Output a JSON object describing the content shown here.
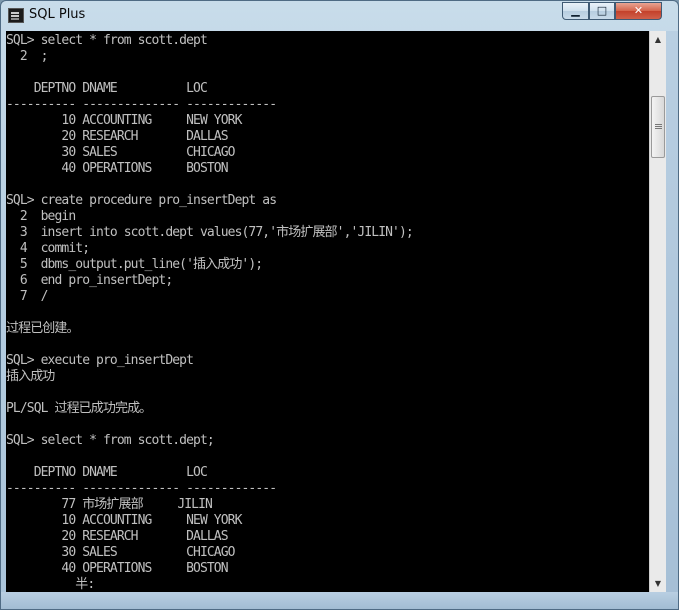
{
  "window": {
    "title": "SQL Plus",
    "minimize_glyph": "▁",
    "maximize_glyph": "□",
    "close_glyph": "✕",
    "icon": "sqlplus-app-icon"
  },
  "console": {
    "lines": [
      "SQL> select * from scott.dept",
      "  2  ;",
      "",
      "    DEPTNO DNAME          LOC",
      "---------- -------------- -------------",
      "        10 ACCOUNTING     NEW YORK",
      "        20 RESEARCH       DALLAS",
      "        30 SALES          CHICAGO",
      "        40 OPERATIONS     BOSTON",
      "",
      "SQL> create procedure pro_insertDept as",
      "  2  begin",
      "  3  insert into scott.dept values(77,'市场扩展部','JILIN');",
      "  4  commit;",
      "  5  dbms_output.put_line('插入成功');",
      "  6  end pro_insertDept;",
      "  7  /",
      "",
      "过程已创建。",
      "",
      "SQL> execute pro_insertDept",
      "插入成功",
      "",
      "PL/SQL 过程已成功完成。",
      "",
      "SQL> select * from scott.dept;",
      "",
      "    DEPTNO DNAME          LOC",
      "---------- -------------- -------------",
      "        77 市场扩展部     JILIN",
      "        10 ACCOUNTING     NEW YORK",
      "        20 RESEARCH       DALLAS",
      "        30 SALES          CHICAGO",
      "        40 OPERATIONS     BOSTON",
      "          半:"
    ]
  },
  "scrollbar": {
    "up_glyph": "▲",
    "down_glyph": "▼"
  },
  "colors": {
    "console_background": "#000000",
    "console_text": "#c0c0c0",
    "title_bar": "#b7cfe2",
    "close_button": "#c3412a"
  }
}
